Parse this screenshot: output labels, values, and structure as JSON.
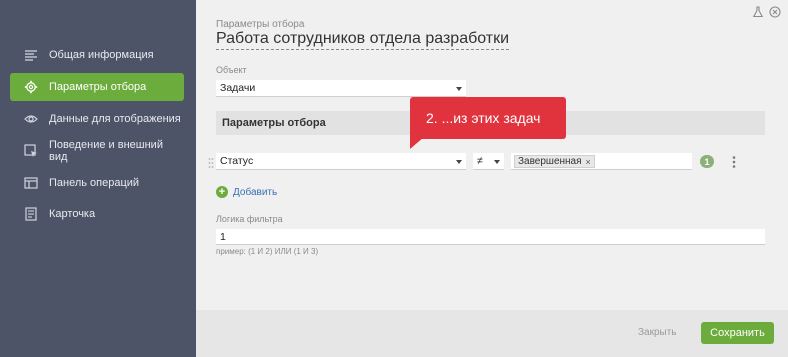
{
  "sidebar": {
    "items": [
      {
        "label": "Общая информация",
        "icon": "list-icon"
      },
      {
        "label": "Параметры отбора",
        "icon": "gear-icon",
        "active": true
      },
      {
        "label": "Данные для отображения",
        "icon": "eye-icon"
      },
      {
        "label": "Поведение и внешний вид",
        "icon": "cursor-icon"
      },
      {
        "label": "Панель операций",
        "icon": "panel-icon"
      },
      {
        "label": "Карточка",
        "icon": "card-icon"
      }
    ]
  },
  "header": {
    "subtitle": "Параметры отбора",
    "title": "Работа сотрудников отдела разработки"
  },
  "object_field": {
    "label": "Объект",
    "value": "Задачи"
  },
  "filter_section": {
    "title": "Параметры отбора"
  },
  "condition": {
    "field": "Статус",
    "operator": "≠",
    "values": [
      "Завершенная"
    ],
    "remove_symbol": "×",
    "number": "1"
  },
  "add_link": {
    "label": "Добавить"
  },
  "logic_field": {
    "label": "Логика фильтра",
    "value": "1",
    "hint": "пример: (1 И 2) ИЛИ (1 И 3)"
  },
  "footer": {
    "close_label": "Закрыть",
    "save_label": "Сохранить"
  },
  "tooltip": {
    "text": "2.  ...из этих задач"
  },
  "colors": {
    "sidebar_bg": "#4e5468",
    "accent_green": "#6cac3c",
    "tooltip_red": "#e0333d",
    "link_blue": "#3a6fb3"
  }
}
